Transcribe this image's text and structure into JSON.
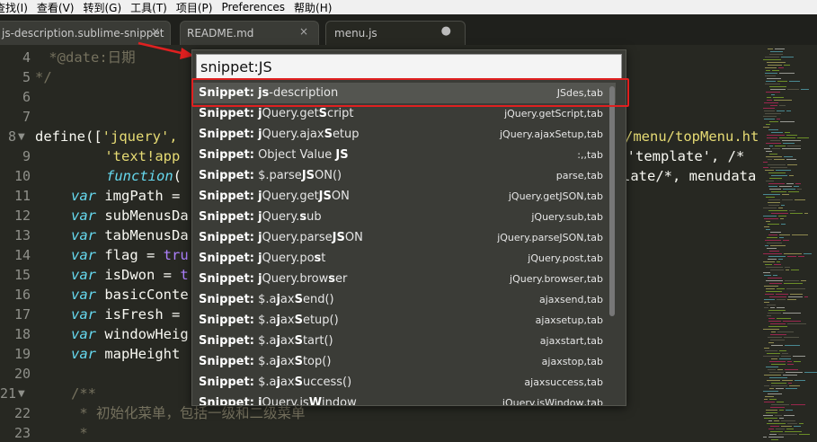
{
  "menubar": [
    "查找(I)",
    "查看(V)",
    "转到(G)",
    "工具(T)",
    "项目(P)",
    "Preferences",
    "帮助(H)"
  ],
  "tabs": [
    {
      "label": "js-description.sublime-snippet",
      "close": "×"
    },
    {
      "label": "README.md",
      "close": "×"
    },
    {
      "label": "menu.js",
      "dot": "●"
    }
  ],
  "editor": {
    "line_numbers": [
      "4",
      "5",
      "6",
      "7",
      "8",
      "9",
      "10",
      "11",
      "12",
      "13",
      "14",
      "15",
      "16",
      "17",
      "18",
      "19",
      "20",
      "21",
      "22",
      "23"
    ],
    "lines": {
      "l4": " *@date:日期",
      "l5": "*/",
      "l8a": "define([",
      "l8b": "'jquery',",
      "l8c": "/menu/topMenu.ht",
      "l9a": "    'text!app",
      "l9b": ", 'template', /*",
      "l10a": "function(",
      "l10b": "late/*, menudata",
      "l11": "imgPath =",
      "l12": "subMenusDa",
      "l13": "tabMenusDa",
      "l14": "flag = ",
      "l14b": "tru",
      "l15": "isDwon = ",
      "l15b": "t",
      "l16": "basicConte",
      "l17": "isFresh = ",
      "l18": "windowHeig",
      "l19": "mapHeight ",
      "l21": "/**",
      "l22": " * 初始化菜单，包括一级和二级菜单",
      "l23": " *"
    },
    "keyword_var": "var",
    "keyword_function": "function"
  },
  "palette": {
    "query": "snippet:JS",
    "items": [
      {
        "prefix": "Snippet:",
        "parts": [
          [
            "b",
            "js"
          ],
          [
            "n",
            "-description"
          ]
        ],
        "hint": "JSdes,tab"
      },
      {
        "prefix": "Snippet:",
        "parts": [
          [
            "b",
            "j"
          ],
          [
            "n",
            "Query.get"
          ],
          [
            "b",
            "S"
          ],
          [
            "n",
            "cript"
          ]
        ],
        "hint": "jQuery.getScript,tab"
      },
      {
        "prefix": "Snippet:",
        "parts": [
          [
            "b",
            "j"
          ],
          [
            "n",
            "Query.ajax"
          ],
          [
            "b",
            "S"
          ],
          [
            "n",
            "etup"
          ]
        ],
        "hint": "jQuery.ajaxSetup,tab"
      },
      {
        "prefix": "Snippet:",
        "parts": [
          [
            "n",
            "Object Value "
          ],
          [
            "b",
            "JS"
          ]
        ],
        "hint": ":,,tab"
      },
      {
        "prefix": "Snippet:",
        "parts": [
          [
            "n",
            "$.parse"
          ],
          [
            "b",
            "JS"
          ],
          [
            "n",
            "ON()"
          ]
        ],
        "hint": "parse,tab"
      },
      {
        "prefix": "Snippet:",
        "parts": [
          [
            "b",
            "j"
          ],
          [
            "n",
            "Query.get"
          ],
          [
            "b",
            "JS"
          ],
          [
            "n",
            "ON"
          ]
        ],
        "hint": "jQuery.getJSON,tab"
      },
      {
        "prefix": "Snippet:",
        "parts": [
          [
            "b",
            "j"
          ],
          [
            "n",
            "Query."
          ],
          [
            "b",
            "s"
          ],
          [
            "n",
            "ub"
          ]
        ],
        "hint": "jQuery.sub,tab"
      },
      {
        "prefix": "Snippet:",
        "parts": [
          [
            "b",
            "j"
          ],
          [
            "n",
            "Query.parse"
          ],
          [
            "b",
            "JS"
          ],
          [
            "n",
            "ON"
          ]
        ],
        "hint": "jQuery.parseJSON,tab"
      },
      {
        "prefix": "Snippet:",
        "parts": [
          [
            "b",
            "j"
          ],
          [
            "n",
            "Query.po"
          ],
          [
            "b",
            "s"
          ],
          [
            "n",
            "t"
          ]
        ],
        "hint": "jQuery.post,tab"
      },
      {
        "prefix": "Snippet:",
        "parts": [
          [
            "b",
            "j"
          ],
          [
            "n",
            "Query.brow"
          ],
          [
            "b",
            "s"
          ],
          [
            "n",
            "er"
          ]
        ],
        "hint": "jQuery.browser,tab"
      },
      {
        "prefix": "Snippet:",
        "parts": [
          [
            "n",
            "$.a"
          ],
          [
            "b",
            "j"
          ],
          [
            "n",
            "ax"
          ],
          [
            "b",
            "S"
          ],
          [
            "n",
            "end()"
          ]
        ],
        "hint": "ajaxsend,tab"
      },
      {
        "prefix": "Snippet:",
        "parts": [
          [
            "n",
            "$.a"
          ],
          [
            "b",
            "j"
          ],
          [
            "n",
            "ax"
          ],
          [
            "b",
            "S"
          ],
          [
            "n",
            "etup()"
          ]
        ],
        "hint": "ajaxsetup,tab"
      },
      {
        "prefix": "Snippet:",
        "parts": [
          [
            "n",
            "$.a"
          ],
          [
            "b",
            "j"
          ],
          [
            "n",
            "ax"
          ],
          [
            "b",
            "S"
          ],
          [
            "n",
            "tart()"
          ]
        ],
        "hint": "ajaxstart,tab"
      },
      {
        "prefix": "Snippet:",
        "parts": [
          [
            "n",
            "$.a"
          ],
          [
            "b",
            "j"
          ],
          [
            "n",
            "ax"
          ],
          [
            "b",
            "S"
          ],
          [
            "n",
            "top()"
          ]
        ],
        "hint": "ajaxstop,tab"
      },
      {
        "prefix": "Snippet:",
        "parts": [
          [
            "n",
            "$.a"
          ],
          [
            "b",
            "j"
          ],
          [
            "n",
            "ax"
          ],
          [
            "b",
            "S"
          ],
          [
            "n",
            "uccess()"
          ]
        ],
        "hint": "ajaxsuccess,tab"
      },
      {
        "prefix": "Snippet:",
        "parts": [
          [
            "b",
            "j"
          ],
          [
            "n",
            "Query.is"
          ],
          [
            "b",
            "W"
          ],
          [
            "n",
            "indow"
          ]
        ],
        "hint": "jQuery.isWindow,tab"
      }
    ]
  },
  "colors": {
    "highlight": "#e02020",
    "background": "#272822"
  }
}
